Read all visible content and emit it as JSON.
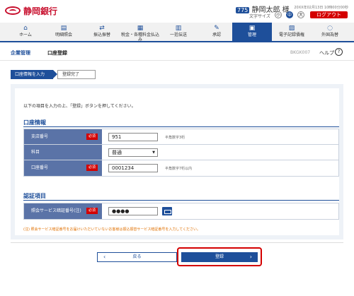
{
  "header": {
    "bank_name": "静岡銀行",
    "user_badge": "775",
    "user_name": "静岡太郎 様",
    "datetime": "20XX年02月13日 10時00分00秒",
    "font_size_label": "文字サイズ",
    "font_sizes": [
      "小",
      "中",
      "大"
    ],
    "logout_label": "ログアウト"
  },
  "nav": [
    {
      "label": "ホーム",
      "icon": "home-icon"
    },
    {
      "label": "明細照会",
      "icon": "document-icon"
    },
    {
      "label": "振込振替",
      "icon": "transfer-icon"
    },
    {
      "label": "税金・各種料金払込み",
      "icon": "tax-icon"
    },
    {
      "label": "一括伝送",
      "icon": "batch-icon"
    },
    {
      "label": "承認",
      "icon": "approval-icon"
    },
    {
      "label": "管理",
      "icon": "manage-icon"
    },
    {
      "label": "電子記録債権",
      "icon": "record-icon"
    },
    {
      "label": "外国為替",
      "icon": "forex-icon"
    }
  ],
  "page": {
    "category": "企業管理",
    "title": "口座登録",
    "code": "BKGK007",
    "help_label": "ヘルプ"
  },
  "steps": [
    "口座情報を入力",
    "登録完了"
  ],
  "instruction": "以下の項目を入力の上、「登録」ボタンを押してください。",
  "account_section": {
    "title": "口座情報",
    "rows": [
      {
        "label": "支店番号",
        "required": "必須",
        "value": "951",
        "hint": "半角数字3桁"
      },
      {
        "label": "科目",
        "required": "",
        "value": "普通",
        "hint": ""
      },
      {
        "label": "口座番号",
        "required": "必須",
        "value": "0001234",
        "hint": "半角数字7桁以内"
      }
    ]
  },
  "auth_section": {
    "title": "認証項目",
    "rows": [
      {
        "label": "照会サービス暗証番号(注)",
        "required": "必須",
        "value": "●●●●"
      }
    ]
  },
  "note": "(注) 照会サービス暗証番号をお届けいただいていないお客様は振込振替サービス暗証番号を入力してください。",
  "buttons": {
    "back": "戻る",
    "register": "登録"
  }
}
